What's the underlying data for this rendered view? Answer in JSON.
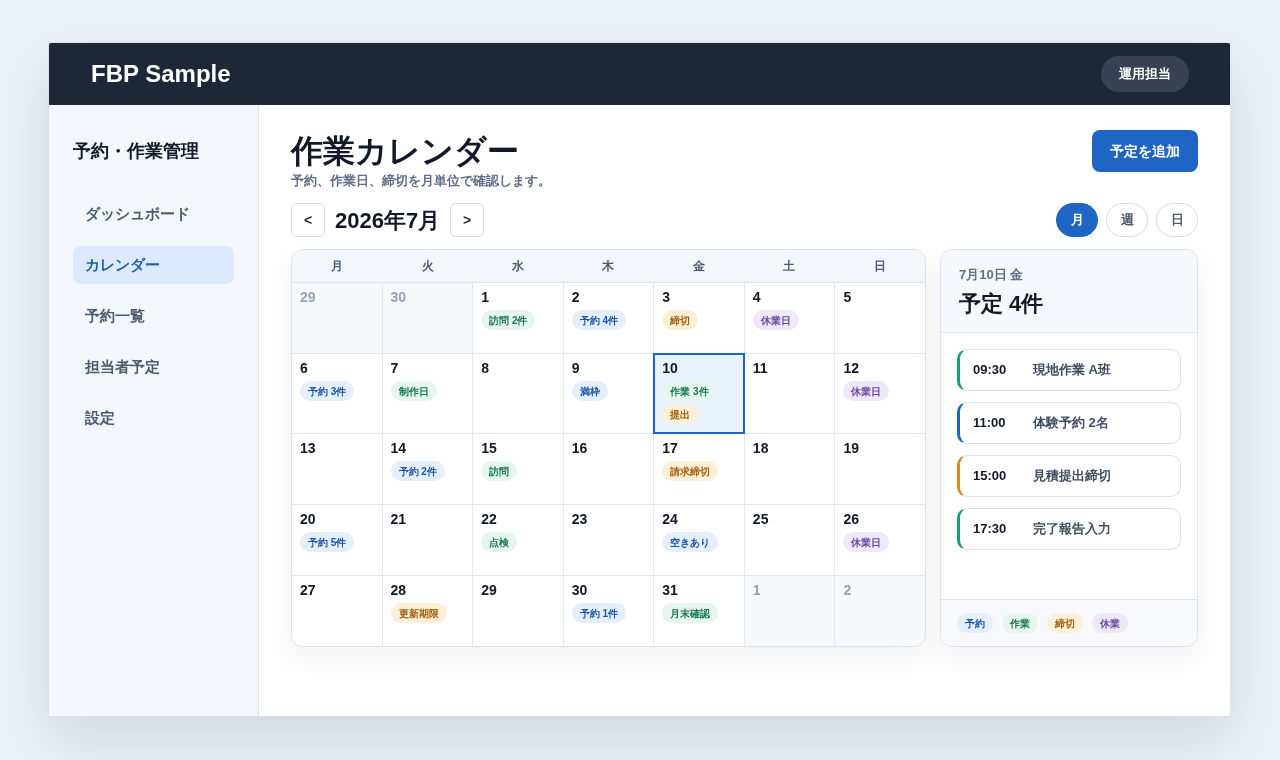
{
  "header": {
    "brand": "FBP Sample",
    "user_button": "運用担当"
  },
  "sidebar": {
    "title": "予約・作業管理",
    "items": [
      {
        "label": "ダッシュボード",
        "selected": false
      },
      {
        "label": "カレンダー",
        "selected": true
      },
      {
        "label": "予約一覧",
        "selected": false
      },
      {
        "label": "担当者予定",
        "selected": false
      },
      {
        "label": "設定",
        "selected": false
      }
    ]
  },
  "page": {
    "title": "作業カレンダー",
    "subtitle": "予約、作業日、締切を月単位で確認します。",
    "add_button": "予定を追加"
  },
  "month_nav": {
    "prev": "<",
    "label": "2026年7月",
    "next": ">"
  },
  "view_tabs": [
    {
      "label": "月",
      "selected": true
    },
    {
      "label": "週",
      "selected": false
    },
    {
      "label": "日",
      "selected": false
    }
  ],
  "calendar": {
    "weekdays": [
      "月",
      "火",
      "水",
      "木",
      "金",
      "土",
      "日"
    ],
    "days": [
      {
        "date": "29",
        "outside": true,
        "selected": false
      },
      {
        "date": "30",
        "outside": true,
        "selected": false
      },
      {
        "date": "1",
        "outside": false,
        "selected": false,
        "tags": [
          {
            "label": "訪問 2件",
            "kind": "work"
          }
        ]
      },
      {
        "date": "2",
        "outside": false,
        "selected": false,
        "tags": [
          {
            "label": "予約 4件",
            "kind": "reservation"
          }
        ]
      },
      {
        "date": "3",
        "outside": false,
        "selected": false,
        "tags": [
          {
            "label": "締切",
            "kind": "deadline"
          }
        ]
      },
      {
        "date": "4",
        "outside": false,
        "selected": false,
        "tags": [
          {
            "label": "休業日",
            "kind": "holiday"
          }
        ]
      },
      {
        "date": "5",
        "outside": false,
        "selected": false
      },
      {
        "date": "6",
        "outside": false,
        "selected": false,
        "tags": [
          {
            "label": "予約 3件",
            "kind": "reservation"
          }
        ]
      },
      {
        "date": "7",
        "outside": false,
        "selected": false,
        "tags": [
          {
            "label": "制作日",
            "kind": "work"
          }
        ]
      },
      {
        "date": "8",
        "outside": false,
        "selected": false
      },
      {
        "date": "9",
        "outside": false,
        "selected": false,
        "tags": [
          {
            "label": "満枠",
            "kind": "reservation"
          }
        ]
      },
      {
        "date": "10",
        "outside": false,
        "selected": true,
        "tags": [
          {
            "label": "作業 3件",
            "kind": "work"
          },
          {
            "label": "提出",
            "kind": "deadline"
          }
        ]
      },
      {
        "date": "11",
        "outside": false,
        "selected": false
      },
      {
        "date": "12",
        "outside": false,
        "selected": false,
        "tags": [
          {
            "label": "休業日",
            "kind": "holiday"
          }
        ]
      },
      {
        "date": "13",
        "outside": false,
        "selected": false
      },
      {
        "date": "14",
        "outside": false,
        "selected": false,
        "tags": [
          {
            "label": "予約 2件",
            "kind": "reservation"
          }
        ]
      },
      {
        "date": "15",
        "outside": false,
        "selected": false,
        "tags": [
          {
            "label": "訪問",
            "kind": "work"
          }
        ]
      },
      {
        "date": "16",
        "outside": false,
        "selected": false
      },
      {
        "date": "17",
        "outside": false,
        "selected": false,
        "tags": [
          {
            "label": "請求締切",
            "kind": "deadline"
          }
        ]
      },
      {
        "date": "18",
        "outside": false,
        "selected": false
      },
      {
        "date": "19",
        "outside": false,
        "selected": false
      },
      {
        "date": "20",
        "outside": false,
        "selected": false,
        "tags": [
          {
            "label": "予約 5件",
            "kind": "reservation"
          }
        ]
      },
      {
        "date": "21",
        "outside": false,
        "selected": false
      },
      {
        "date": "22",
        "outside": false,
        "selected": false,
        "tags": [
          {
            "label": "点検",
            "kind": "work"
          }
        ]
      },
      {
        "date": "23",
        "outside": false,
        "selected": false
      },
      {
        "date": "24",
        "outside": false,
        "selected": false,
        "tags": [
          {
            "label": "空きあり",
            "kind": "reservation"
          }
        ]
      },
      {
        "date": "25",
        "outside": false,
        "selected": false
      },
      {
        "date": "26",
        "outside": false,
        "selected": false,
        "tags": [
          {
            "label": "休業日",
            "kind": "holiday"
          }
        ]
      },
      {
        "date": "27",
        "outside": false,
        "selected": false
      },
      {
        "date": "28",
        "outside": false,
        "selected": false,
        "tags": [
          {
            "label": "更新期限",
            "kind": "deadline"
          }
        ]
      },
      {
        "date": "29",
        "outside": false,
        "selected": false
      },
      {
        "date": "30",
        "outside": false,
        "selected": false,
        "tags": [
          {
            "label": "予約 1件",
            "kind": "reservation"
          }
        ]
      },
      {
        "date": "31",
        "outside": false,
        "selected": false,
        "tags": [
          {
            "label": "月末確認",
            "kind": "work"
          }
        ]
      },
      {
        "date": "1",
        "outside": true,
        "selected": false
      },
      {
        "date": "2",
        "outside": true,
        "selected": false
      }
    ]
  },
  "day_panel": {
    "date": "7月10日 金",
    "title": "予定 4件",
    "events": [
      {
        "time": "09:30",
        "title": "現地作業 A班",
        "kind": "work"
      },
      {
        "time": "11:00",
        "title": "体験予約 2名",
        "kind": "reservation"
      },
      {
        "time": "15:00",
        "title": "見積提出締切",
        "kind": "deadline"
      },
      {
        "time": "17:30",
        "title": "完了報告入力",
        "kind": "work"
      }
    ],
    "legend": [
      {
        "label": "予約",
        "kind": "reservation"
      },
      {
        "label": "作業",
        "kind": "work"
      },
      {
        "label": "締切",
        "kind": "deadline"
      },
      {
        "label": "休業",
        "kind": "holiday"
      }
    ]
  }
}
